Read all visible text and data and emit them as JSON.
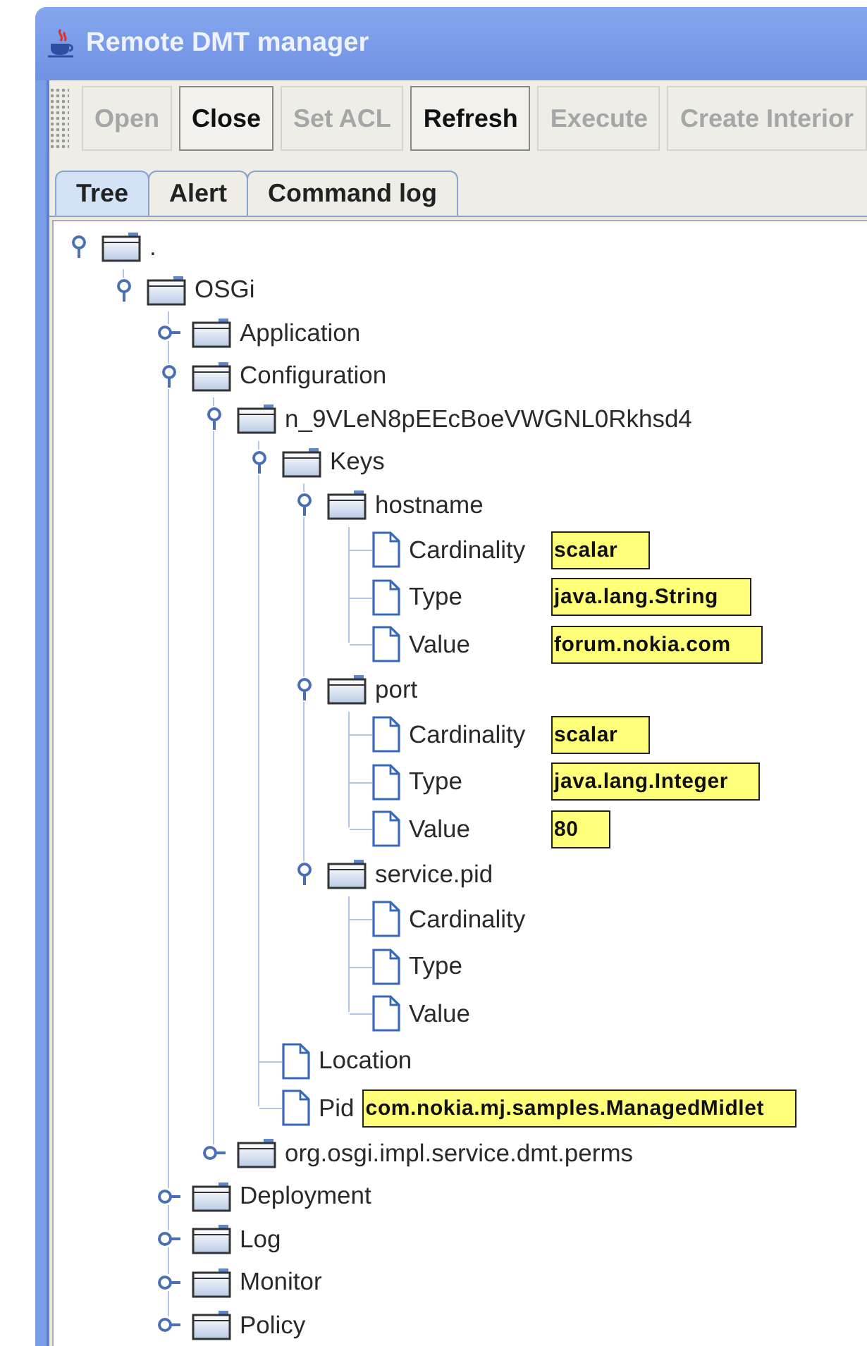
{
  "window": {
    "title": "Remote DMT manager"
  },
  "toolbar": [
    {
      "label": "Open",
      "disabled": true
    },
    {
      "label": "Close",
      "disabled": false
    },
    {
      "label": "Set ACL",
      "disabled": true
    },
    {
      "label": "Refresh",
      "disabled": false
    },
    {
      "label": "Execute",
      "disabled": true
    },
    {
      "label": "Create Interior",
      "disabled": true
    }
  ],
  "tabs": [
    {
      "label": "Tree",
      "selected": true
    },
    {
      "label": "Alert",
      "selected": false
    },
    {
      "label": "Command log",
      "selected": false
    }
  ],
  "tree": [
    {
      "label": ".",
      "kind": "folder",
      "expanded": true,
      "children": [
        {
          "label": "OSGi",
          "kind": "folder",
          "expanded": true,
          "children": [
            {
              "label": "Application",
              "kind": "folder",
              "expanded": false
            },
            {
              "label": "Configuration",
              "kind": "folder",
              "expanded": true,
              "children": [
                {
                  "label": "n_9VLeN8pEEcBoeVWGNL0Rkhsd4",
                  "kind": "folder",
                  "expanded": true,
                  "children": [
                    {
                      "label": "Keys",
                      "kind": "folder",
                      "expanded": true,
                      "children": [
                        {
                          "label": "hostname",
                          "kind": "folder",
                          "expanded": true,
                          "children": [
                            {
                              "label": "Cardinality",
                              "kind": "leaf",
                              "value": "scalar"
                            },
                            {
                              "label": "Type",
                              "kind": "leaf",
                              "value": "java.lang.String"
                            },
                            {
                              "label": "Value",
                              "kind": "leaf",
                              "value": "forum.nokia.com"
                            }
                          ]
                        },
                        {
                          "label": "port",
                          "kind": "folder",
                          "expanded": true,
                          "children": [
                            {
                              "label": "Cardinality",
                              "kind": "leaf",
                              "value": "scalar"
                            },
                            {
                              "label": "Type",
                              "kind": "leaf",
                              "value": "java.lang.Integer"
                            },
                            {
                              "label": "Value",
                              "kind": "leaf",
                              "value": "80"
                            }
                          ]
                        },
                        {
                          "label": "service.pid",
                          "kind": "folder",
                          "expanded": true,
                          "children": [
                            {
                              "label": "Cardinality",
                              "kind": "leaf"
                            },
                            {
                              "label": "Type",
                              "kind": "leaf"
                            },
                            {
                              "label": "Value",
                              "kind": "leaf"
                            }
                          ]
                        }
                      ]
                    },
                    {
                      "label": "Location",
                      "kind": "leaf"
                    },
                    {
                      "label": "Pid",
                      "kind": "leaf",
                      "value": "com.nokia.mj.samples.ManagedMidlet"
                    }
                  ]
                },
                {
                  "label": "org.osgi.impl.service.dmt.perms",
                  "kind": "folder",
                  "expanded": false
                }
              ]
            },
            {
              "label": "Deployment",
              "kind": "folder",
              "expanded": false
            },
            {
              "label": "Log",
              "kind": "folder",
              "expanded": false
            },
            {
              "label": "Monitor",
              "kind": "folder",
              "expanded": false
            },
            {
              "label": "Policy",
              "kind": "folder",
              "expanded": false
            }
          ]
        }
      ]
    }
  ]
}
